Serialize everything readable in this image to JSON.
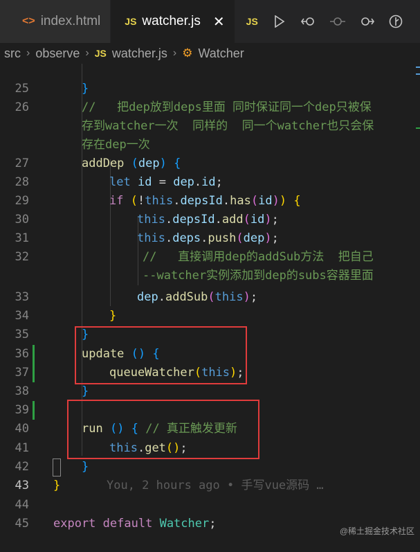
{
  "tabs": [
    {
      "label": "index.html",
      "icon": "html-icon",
      "icon_glyph": "<>",
      "active": false
    },
    {
      "label": "watcher.js",
      "icon": "js-icon",
      "icon_glyph": "JS",
      "active": true
    }
  ],
  "toolbar": {
    "badge": "JS"
  },
  "breadcrumb": {
    "items": [
      "src",
      "observe",
      "watcher.js",
      "Watcher"
    ],
    "js_badge": "JS"
  },
  "lines": {
    "n25": "25",
    "n26": "26",
    "n27": "27",
    "n28": "28",
    "n29": "29",
    "n30": "30",
    "n31": "31",
    "n32": "32",
    "n33": "33",
    "n34": "34",
    "n35": "35",
    "n36": "36",
    "n37": "37",
    "n38": "38",
    "n39": "39",
    "n40": "40",
    "n41": "41",
    "n42": "42",
    "n43": "43",
    "n44": "44",
    "n45": "45"
  },
  "comments": {
    "c26a": "//   把dep放到deps里面 同时保证同一个dep只被保",
    "c26b": "存到watcher一次  同样的  同一个watcher也只会保",
    "c26c": "存在dep一次",
    "c32a": "//   直接调用dep的addSub方法  把自己",
    "c32b": "--watcher实例添加到dep的subs容器里面",
    "c40": "// 真正触发更新"
  },
  "blame": "You, 2 hours ago • 手写vue源码 …",
  "watermark": "@稀土掘金技术社区",
  "colors": {
    "highlight": "#e03c3c",
    "keyword": "#569cd6",
    "comment": "#6a9955"
  }
}
